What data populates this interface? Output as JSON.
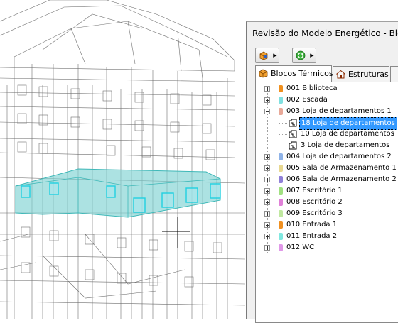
{
  "panel": {
    "title": "Revisão do Modelo Energético - Bloco"
  },
  "toolbar": {
    "buttons": [
      {
        "icon": "model-view-icon"
      },
      {
        "icon": "refresh-icon"
      }
    ]
  },
  "tabs": [
    {
      "label": "Blocos Térmicos",
      "icon": "thermal-blocks-icon",
      "active": true
    },
    {
      "label": "Estruturas",
      "icon": "structures-icon",
      "active": false
    }
  ],
  "tree": {
    "items": [
      {
        "label": "001 Biblioteca",
        "color": "#f0901e",
        "expanded": false
      },
      {
        "label": "002 Escada",
        "color": "#7fe0e0",
        "expanded": false
      },
      {
        "label": "003 Loja de departamentos 1",
        "color": "#e8a898",
        "expanded": true,
        "children": [
          {
            "label": "18 Loja de departamentos",
            "selected": true
          },
          {
            "label": "10 Loja de departamentos",
            "selected": false
          },
          {
            "label": "3 Loja de departamentos",
            "selected": false
          }
        ]
      },
      {
        "label": "004 Loja de departamentos 2",
        "color": "#8fb3e8",
        "expanded": false
      },
      {
        "label": "005 Sala de Armazenamento 1",
        "color": "#e8d890",
        "expanded": false
      },
      {
        "label": "006 Sala de Armazenamento 2",
        "color": "#9080d8",
        "expanded": false
      },
      {
        "label": "007 Escritório 1",
        "color": "#a0e080",
        "expanded": false
      },
      {
        "label": "008 Escritório 2",
        "color": "#e080d8",
        "expanded": false
      },
      {
        "label": "009 Escritório 3",
        "color": "#c0e8a0",
        "expanded": false
      },
      {
        "label": "010 Entrada 1",
        "color": "#f09020",
        "expanded": false
      },
      {
        "label": "011 Entrada 2",
        "color": "#80e8e0",
        "expanded": false
      },
      {
        "label": "012 WC",
        "color": "#e098e8",
        "expanded": false
      }
    ]
  }
}
